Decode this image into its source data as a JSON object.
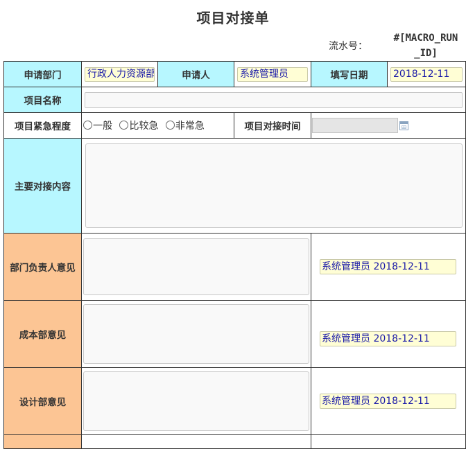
{
  "form": {
    "title": "项目对接单",
    "serial_label": "流水号：",
    "serial_value_line1": "#[MACRO_RUN",
    "serial_value_line2": "_ID]"
  },
  "fields": {
    "department_label": "申请部门",
    "department_value": "行政人力资源部",
    "applicant_label": "申请人",
    "applicant_value": "系统管理员",
    "date_label": "填写日期",
    "date_value": "2018-12-11",
    "project_name_label": "项目名称",
    "project_name_value": "",
    "urgency_label": "项目紧急程度",
    "urgency_options": [
      "一般",
      "比较急",
      "非常急"
    ],
    "docking_time_label": "项目对接时间",
    "docking_time_value": "",
    "main_content_label": "主要对接内容",
    "main_content_value": ""
  },
  "opinions": [
    {
      "label": "部门负责人意见",
      "signer": "系统管理员 2018-12-11"
    },
    {
      "label": "成本部意见",
      "signer": "系统管理员 2018-12-11"
    },
    {
      "label": "设计部意见",
      "signer": "系统管理员 2018-12-11"
    }
  ],
  "colors": {
    "label_cyan": "#b7f7ff",
    "label_orange": "#fcc594",
    "signed_field_bg": "#fffed5",
    "signed_text": "#1a1aa8"
  }
}
